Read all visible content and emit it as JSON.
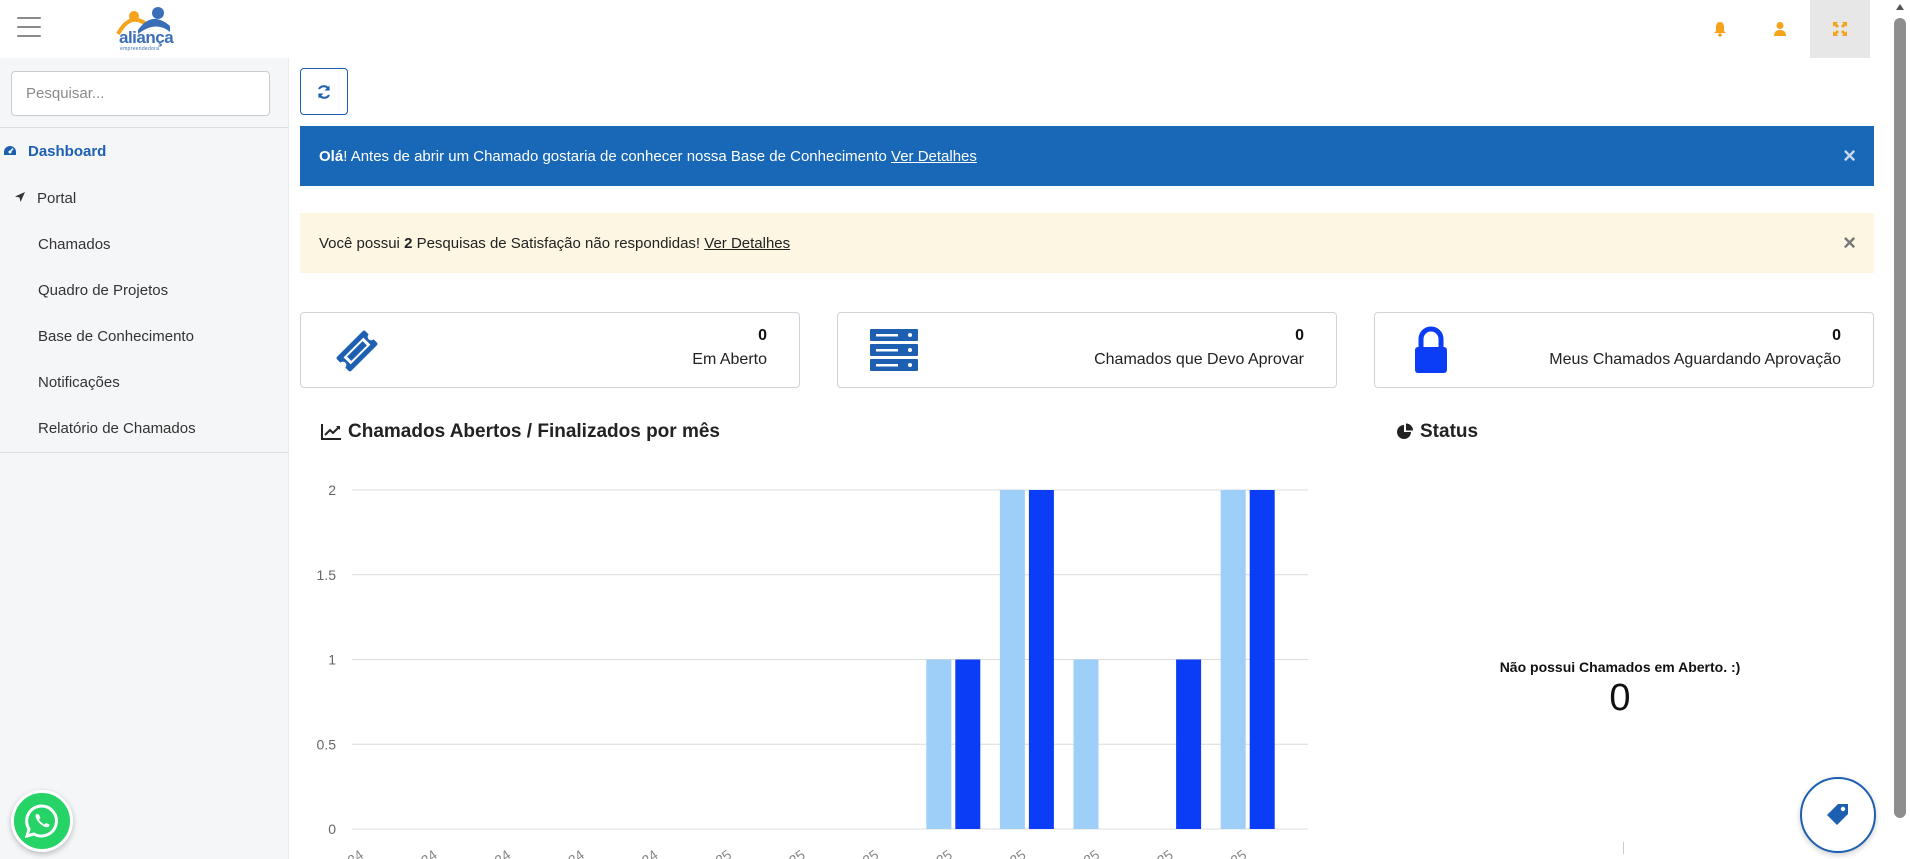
{
  "header": {
    "logo_text": "aliança",
    "logo_subtext": "empreendedora",
    "icons": [
      "bell-icon",
      "user-icon",
      "expand-icon"
    ]
  },
  "sidebar": {
    "search_placeholder": "Pesquisar...",
    "items": [
      {
        "label": "Dashboard",
        "icon": "dashboard-icon"
      },
      {
        "label": "Portal",
        "icon": "location-arrow-icon"
      },
      {
        "label": "Chamados"
      },
      {
        "label": "Quadro de Projetos"
      },
      {
        "label": "Base de Conhecimento"
      },
      {
        "label": "Notificações"
      },
      {
        "label": "Relatório de Chamados"
      }
    ]
  },
  "alerts": {
    "info": {
      "bold": "Olá",
      "text": "! Antes de abrir um Chamado gostaria de conhecer nossa Base de Conhecimento ",
      "link": "Ver Detalhes",
      "close": "×"
    },
    "warning": {
      "pre": "Você possui ",
      "count": "2",
      "text": " Pesquisas de Satisfação não respondidas! ",
      "link": "Ver Detalhes",
      "close": "×"
    }
  },
  "cards": [
    {
      "value": "0",
      "label": "Em Aberto",
      "icon": "ticket-icon"
    },
    {
      "value": "0",
      "label": "Chamados que Devo Aprovar",
      "icon": "server-icon"
    },
    {
      "value": "0",
      "label": "Meus Chamados Aguardando Aprovação",
      "icon": "lock-icon"
    }
  ],
  "chart_section": {
    "title": "Chamados Abertos / Finalizados por mês"
  },
  "status_section": {
    "title": "Status",
    "empty_message": "Não possui Chamados em Aberto. :)",
    "empty_value": "0"
  },
  "colors": {
    "primary": "#1868b7",
    "series_light": "#9ecff9",
    "series_dark": "#0a3df5",
    "warning_bg": "#fdf6e3",
    "accent_orange": "#f5a31a",
    "whatsapp": "#25d366"
  },
  "chart_data": {
    "type": "bar",
    "categories": [
      "",
      "",
      "",
      "",
      "",
      "",
      "",
      "",
      "",
      "",
      "",
      "",
      "",
      ""
    ],
    "x_tick_labels_partial": [
      "24",
      "24",
      "24",
      "24",
      "24",
      "25",
      "25",
      "25",
      "25",
      "25",
      "25",
      "25",
      "25"
    ],
    "series": [
      {
        "values": [
          0,
          0,
          0,
          0,
          0,
          0,
          0,
          0,
          1,
          2,
          1,
          0,
          2
        ]
      },
      {
        "values": [
          0,
          0,
          0,
          0,
          0,
          0,
          0,
          0,
          1,
          2,
          0,
          1,
          2
        ]
      }
    ],
    "yticks": [
      "0",
      "0.5",
      "1",
      "1.5",
      "2"
    ],
    "ylim": [
      0,
      2
    ],
    "grid": true,
    "xlabel": "",
    "ylabel": "",
    "title": ""
  }
}
